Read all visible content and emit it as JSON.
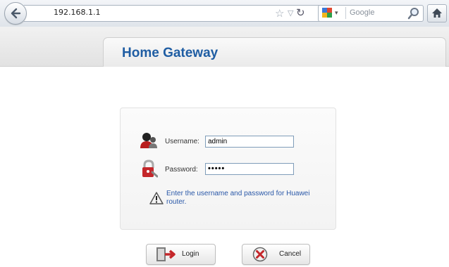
{
  "browser": {
    "url": "192.168.1.1",
    "search_placeholder": "Google",
    "back_icon": "arrow-left-icon",
    "home_icon": "home-icon",
    "search_icon": "magnifier-icon"
  },
  "page": {
    "title": "Home Gateway",
    "accent_color": "#1f5da3"
  },
  "login": {
    "username_label": "Username:",
    "username_value": "admin",
    "password_label": "Password:",
    "password_value": "•••••",
    "hint": "Enter the username and password for Huawei router.",
    "login_label": "Login",
    "cancel_label": "Cancel"
  }
}
